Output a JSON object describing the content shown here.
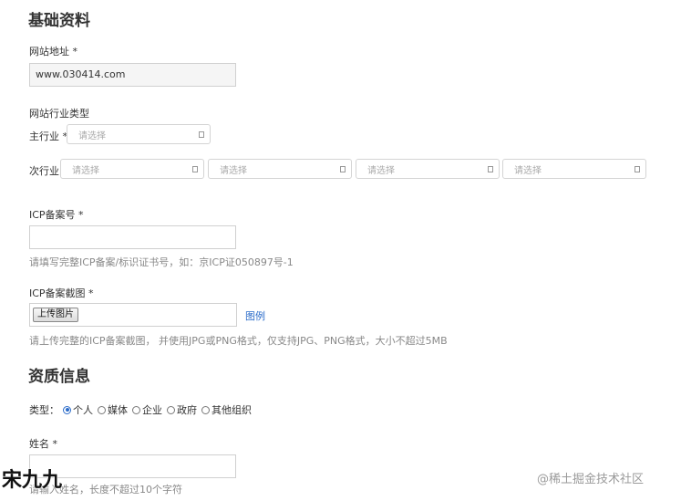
{
  "basic": {
    "title": "基础资料",
    "website": {
      "label": "网站地址 *",
      "value": "www.030414.com"
    },
    "industry": {
      "label": "网站行业类型",
      "main_label": "主行业 *",
      "main_placeholder": "请选择",
      "sub_label": "次行业",
      "sub_placeholders": [
        "请选择",
        "请选择",
        "请选择",
        "请选择"
      ]
    },
    "icp": {
      "label": "ICP备案号 *",
      "value": "",
      "hint": "请填写完整ICP备案/标识证书号，如：京ICP证050897号-1"
    },
    "icp_screenshot": {
      "label": "ICP备案截图 *",
      "upload_label": "上传图片",
      "example_link": "图例",
      "hint": "请上传完整的ICP备案截图， 并使用JPG或PNG格式，仅支持JPG、PNG格式，大小不超过5MB"
    }
  },
  "qualification": {
    "title": "资质信息",
    "type_label": "类型：",
    "type_options": [
      "个人",
      "媒体",
      "企业",
      "政府",
      "其他组织"
    ],
    "type_selected": "个人",
    "name_label": "姓名 *",
    "name_value": "",
    "name_hint": "请输入姓名，长度不超过10个字符"
  },
  "watermark": {
    "left": "宋九九",
    "right": "@稀土掘金技术社区"
  },
  "colors": {
    "accent": "#2a6bc9",
    "border": "#d0d0d0",
    "hint": "#888888"
  },
  "icons": {
    "select_caret": "square-caret-icon",
    "radio_checked": "radio-checked-icon",
    "radio_unchecked": "radio-unchecked-icon"
  }
}
